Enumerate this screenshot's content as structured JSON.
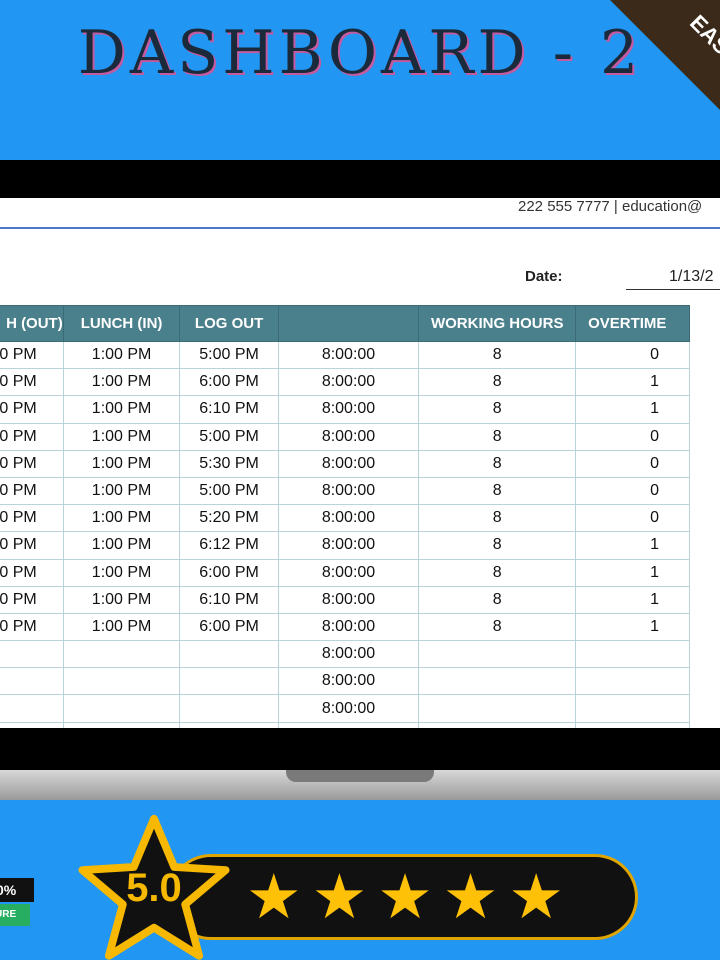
{
  "title": "DASHBOARD - 2",
  "corner_ribbon": "EAS",
  "contact": "222 555 7777 | education@",
  "date": {
    "label": "Date:",
    "value": "1/13/2"
  },
  "table": {
    "headers": [
      "H (OUT)",
      "LUNCH (IN)",
      "LOG OUT",
      "",
      "WORKING HOURS",
      "OVERTIME"
    ],
    "rows": [
      [
        "00 PM",
        "1:00 PM",
        "5:00 PM",
        "8:00:00",
        "8",
        "0"
      ],
      [
        "00 PM",
        "1:00 PM",
        "6:00 PM",
        "8:00:00",
        "8",
        "1"
      ],
      [
        "00 PM",
        "1:00 PM",
        "6:10 PM",
        "8:00:00",
        "8",
        "1"
      ],
      [
        "00 PM",
        "1:00 PM",
        "5:00 PM",
        "8:00:00",
        "8",
        "0"
      ],
      [
        "00 PM",
        "1:00 PM",
        "5:30 PM",
        "8:00:00",
        "8",
        "0"
      ],
      [
        "00 PM",
        "1:00 PM",
        "5:00 PM",
        "8:00:00",
        "8",
        "0"
      ],
      [
        "00 PM",
        "1:00 PM",
        "5:20 PM",
        "8:00:00",
        "8",
        "0"
      ],
      [
        "00 PM",
        "1:00 PM",
        "6:12 PM",
        "8:00:00",
        "8",
        "1"
      ],
      [
        "00 PM",
        "1:00 PM",
        "6:00 PM",
        "8:00:00",
        "8",
        "1"
      ],
      [
        "00 PM",
        "1:00 PM",
        "6:10 PM",
        "8:00:00",
        "8",
        "1"
      ],
      [
        "00 PM",
        "1:00 PM",
        "6:00 PM",
        "8:00:00",
        "8",
        "1"
      ],
      [
        "",
        "",
        "",
        "8:00:00",
        "",
        ""
      ],
      [
        "",
        "",
        "",
        "8:00:00",
        "",
        ""
      ],
      [
        "",
        "",
        "",
        "8:00:00",
        "",
        ""
      ],
      [
        "",
        "",
        "",
        "",
        "",
        ""
      ]
    ]
  },
  "rating": {
    "score": "5.0",
    "stars": 5,
    "badge_top": "0%",
    "badge_bottom": "URE",
    "colors": {
      "star": "#ffc107",
      "accent": "#e0a500",
      "badge_green": "#27ae60"
    }
  },
  "colors": {
    "background": "#2196f3",
    "header": "#4a7f8c",
    "title_shadow": "#c45aa0"
  }
}
